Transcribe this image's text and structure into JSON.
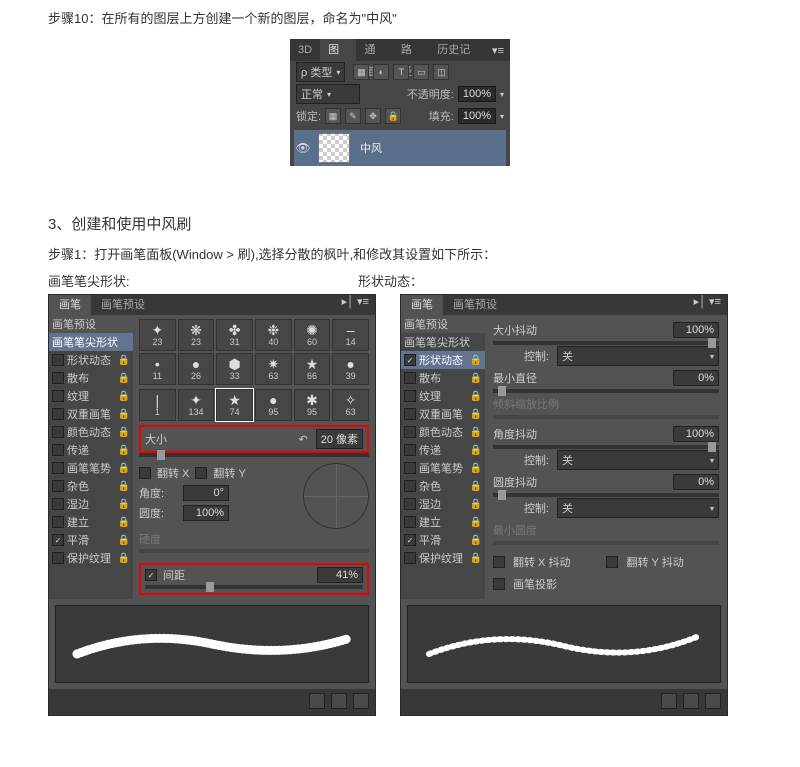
{
  "step10": "步骤10：在所有的图层上方创建一个新的图层，命名为\"中风\"",
  "layers": {
    "tabs": [
      "3D",
      "图层",
      "通道",
      "路径",
      "历史记录"
    ],
    "kindLabel": "ρ 类型",
    "blend": "正常",
    "opacityLabel": "不透明度:",
    "opacityVal": "100%",
    "lockLabel": "锁定:",
    "fillLabel": "填充:",
    "fillVal": "100%",
    "layerName": "中风"
  },
  "section3": "3、创建和使用中风刷",
  "step1": "步骤1：打开画笔面板(Window > 刷),选择分散的枫叶,和修改其设置如下所示：",
  "labelLeft": "画笔笔尖形状:",
  "labelRight": "形状动态：",
  "brushA": {
    "tabs": [
      "画笔",
      "画笔预设"
    ],
    "sideHdr": "画笔预设",
    "side": [
      {
        "label": "画笔笔尖形状",
        "hl": true,
        "cb": false
      },
      {
        "label": "形状动态",
        "cb": true,
        "lock": true
      },
      {
        "label": "散布",
        "cb": true,
        "lock": true
      },
      {
        "label": "纹理",
        "cb": true,
        "lock": true
      },
      {
        "label": "双重画笔",
        "cb": true,
        "lock": true
      },
      {
        "label": "颜色动态",
        "cb": true,
        "lock": true
      },
      {
        "label": "传递",
        "cb": true,
        "lock": true
      },
      {
        "label": "画笔笔势",
        "cb": true,
        "lock": true
      },
      {
        "label": "杂色",
        "cb": true,
        "lock": true
      },
      {
        "label": "湿边",
        "cb": true,
        "lock": true
      },
      {
        "label": "建立",
        "cb": true,
        "lock": true
      },
      {
        "label": "平滑",
        "cb": true,
        "on": true,
        "lock": true
      },
      {
        "label": "保护纹理",
        "cb": true,
        "lock": true
      }
    ],
    "thumbs": [
      "23",
      "23",
      "31",
      "40",
      "60",
      "14",
      "11",
      "26",
      "33",
      "63",
      "66",
      "39",
      "1",
      "134",
      "74",
      "95",
      "95",
      "63"
    ],
    "sizeLabel": "大小",
    "sizeVal": "20 像素",
    "undo": "↶",
    "flipX": "翻转 X",
    "flipY": "翻转 Y",
    "angleLabel": "角度:",
    "angleVal": "0°",
    "roundLabel": "圆度:",
    "roundVal": "100%",
    "hardLabel": "硬度",
    "spacingLabel": "间距",
    "spacingVal": "41%"
  },
  "brushB": {
    "tabs": [
      "画笔",
      "画笔预设"
    ],
    "sideHdr": "画笔预设",
    "side": [
      {
        "label": "画笔笔尖形状",
        "cb": false
      },
      {
        "label": "形状动态",
        "cb": true,
        "on": true,
        "hl": true,
        "lock": true
      },
      {
        "label": "散布",
        "cb": true,
        "lock": true
      },
      {
        "label": "纹理",
        "cb": true,
        "lock": true
      },
      {
        "label": "双重画笔",
        "cb": true,
        "lock": true
      },
      {
        "label": "颜色动态",
        "cb": true,
        "lock": true
      },
      {
        "label": "传递",
        "cb": true,
        "lock": true
      },
      {
        "label": "画笔笔势",
        "cb": true,
        "lock": true
      },
      {
        "label": "杂色",
        "cb": true,
        "lock": true
      },
      {
        "label": "湿边",
        "cb": true,
        "lock": true
      },
      {
        "label": "建立",
        "cb": true,
        "lock": true
      },
      {
        "label": "平滑",
        "cb": true,
        "on": true,
        "lock": true
      },
      {
        "label": "保护纹理",
        "cb": true,
        "lock": true
      }
    ],
    "sizeJitter": "大小抖动",
    "sizeJitterVal": "100%",
    "controlLabel": "控制:",
    "controlVal": "关",
    "minDiam": "最小直径",
    "minDiamVal": "0%",
    "tiltScale": "倾斜缩放比例",
    "angJitter": "角度抖动",
    "angJitterVal": "100%",
    "roundJitter": "圆度抖动",
    "roundJitterVal": "0%",
    "minRound": "最小圆度",
    "flipXJ": "翻转 X 抖动",
    "flipYJ": "翻转 Y 抖动",
    "brushProj": "画笔投影"
  }
}
